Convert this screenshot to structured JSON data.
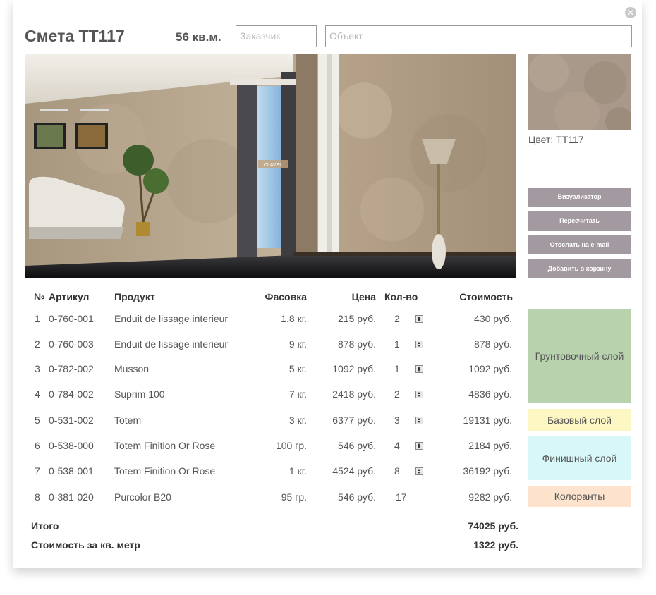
{
  "header": {
    "title": "Смета TT117",
    "area": "56 кв.м.",
    "customer_placeholder": "Заказчик",
    "object_placeholder": "Объект"
  },
  "preview": {
    "badge": "CLAVEL"
  },
  "swatch": {
    "color_label": "Цвет: TT117"
  },
  "actions": {
    "visualizer": "Визуализатор",
    "recalc": "Пересчитать",
    "email": "Отослать на e-mail",
    "cart": "Добавить в корзину"
  },
  "table": {
    "columns": {
      "num": "№",
      "article": "Артикул",
      "product": "Продукт",
      "pack": "Фасовка",
      "price": "Цена",
      "qty": "Кол-во",
      "cost": "Стоимость"
    },
    "rows": [
      {
        "num": "1",
        "article": "0-760-001",
        "product": "Enduit de lissage interieur",
        "pack": "1.8 кг.",
        "price": "215 руб.",
        "qty": "2",
        "cost": "430 руб."
      },
      {
        "num": "2",
        "article": "0-760-003",
        "product": "Enduit de lissage interieur",
        "pack": "9 кг.",
        "price": "878 руб.",
        "qty": "1",
        "cost": "878 руб."
      },
      {
        "num": "3",
        "article": "0-782-002",
        "product": "Musson",
        "pack": "5 кг.",
        "price": "1092 руб.",
        "qty": "1",
        "cost": "1092 руб."
      },
      {
        "num": "4",
        "article": "0-784-002",
        "product": "Suprim 100",
        "pack": "7 кг.",
        "price": "2418 руб.",
        "qty": "2",
        "cost": "4836 руб."
      },
      {
        "num": "5",
        "article": "0-531-002",
        "product": "Totem",
        "pack": "3 кг.",
        "price": "6377 руб.",
        "qty": "3",
        "cost": "19131 руб."
      },
      {
        "num": "6",
        "article": "0-538-000",
        "product": "Totem Finition Or Rose",
        "pack": "100 гр.",
        "price": "546 руб.",
        "qty": "4",
        "cost": "2184 руб."
      },
      {
        "num": "7",
        "article": "0-538-001",
        "product": "Totem Finition Or Rose",
        "pack": "1 кг.",
        "price": "4524 руб.",
        "qty": "8",
        "cost": "36192 руб."
      },
      {
        "num": "8",
        "article": "0-381-020",
        "product": "Purcolor B20",
        "pack": "95 гр.",
        "price": "546 руб.",
        "qty": "17",
        "cost": "9282 руб."
      }
    ]
  },
  "layers": {
    "primer": "Грунтовочный слой",
    "base": "Базовый слой",
    "finish": "Финишный слой",
    "colorants": "Колоранты",
    "colors": {
      "primer": "#b9d2ae",
      "base": "#fdf7c3",
      "finish": "#d8f7f9",
      "colorants": "#fde3cd"
    }
  },
  "totals": {
    "total_label": "Итого",
    "total_value": "74025 руб.",
    "per_sqm_label": "Стоимость за кв. метр",
    "per_sqm_value": "1322 руб."
  }
}
